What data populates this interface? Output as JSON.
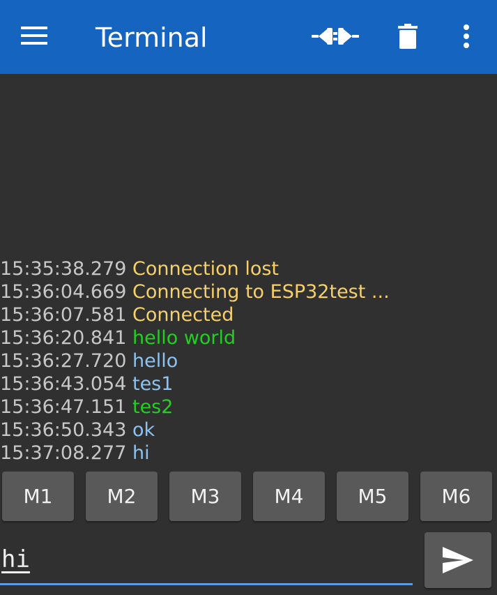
{
  "appbar": {
    "title": "Terminal",
    "background_color": "#1565c0",
    "icons": {
      "menu": "hamburger-menu-icon",
      "connect": "plug-connect-icon",
      "delete": "trash-icon",
      "overflow": "more-vert-icon"
    }
  },
  "colors": {
    "status": "#f5d06b",
    "received": "#22d022",
    "sent": "#8ec3f0",
    "timestamp": "#c7c7c7"
  },
  "log": [
    {
      "time": "15:35:38.279",
      "text": "Connection lost",
      "kind": "status"
    },
    {
      "time": "15:36:04.669",
      "text": "Connecting to ESP32test ...",
      "kind": "status"
    },
    {
      "time": "15:36:07.581",
      "text": "Connected",
      "kind": "status"
    },
    {
      "time": "15:36:20.841",
      "text": "hello world",
      "kind": "received"
    },
    {
      "time": "15:36:27.720",
      "text": "hello",
      "kind": "sent"
    },
    {
      "time": "15:36:43.054",
      "text": "tes1",
      "kind": "sent"
    },
    {
      "time": "15:36:47.151",
      "text": "tes2",
      "kind": "received"
    },
    {
      "time": "15:36:50.343",
      "text": "ok",
      "kind": "sent"
    },
    {
      "time": "15:37:08.277",
      "text": "hi",
      "kind": "sent"
    }
  ],
  "macros": [
    "M1",
    "M2",
    "M3",
    "M4",
    "M5",
    "M6"
  ],
  "input": {
    "value": "hi",
    "underline_color": "#5b9be6"
  },
  "send": {
    "icon": "send-icon"
  }
}
